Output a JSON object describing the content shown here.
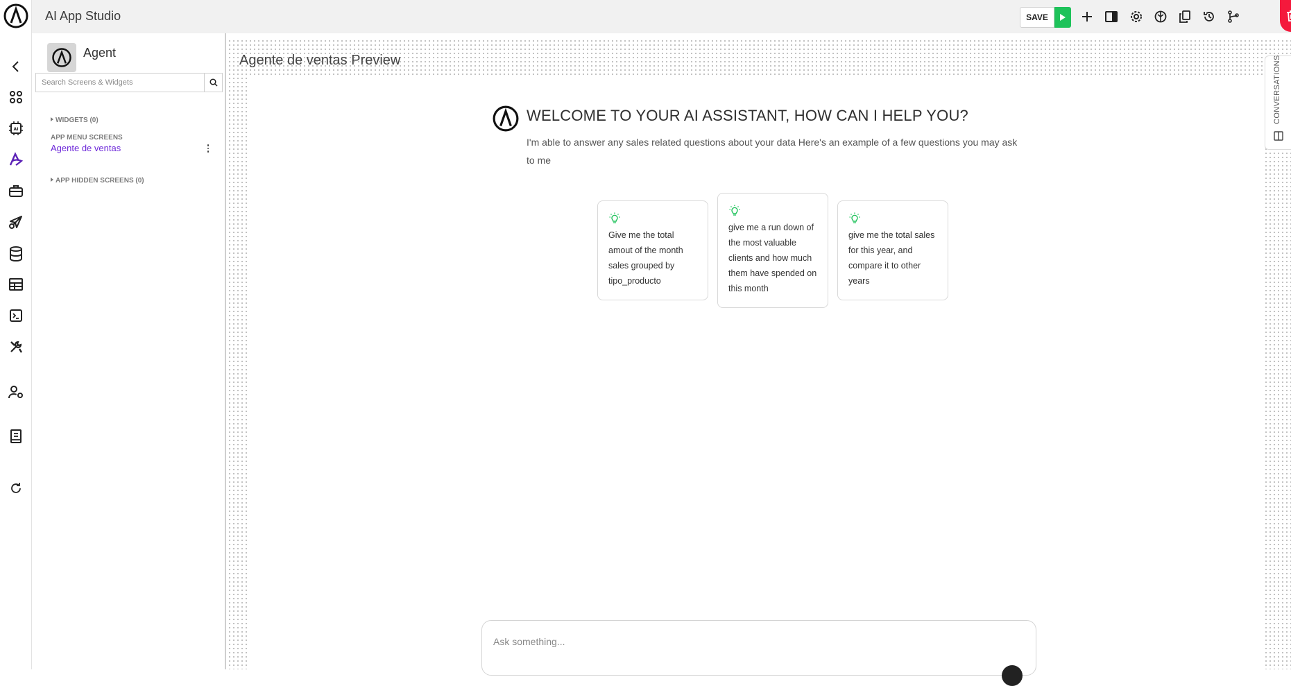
{
  "app": {
    "title": "AI App Studio"
  },
  "toolbar": {
    "save_label": "SAVE",
    "icons": [
      "plus-icon",
      "panel-icon",
      "gear-icon",
      "globe-icon",
      "copy-icon",
      "history-icon",
      "branch-icon",
      "trash-icon"
    ]
  },
  "rail": {
    "icons": [
      "logo",
      "back-icon",
      "apps-icon",
      "ai-chip-icon",
      "studio-icon",
      "toolbox-icon",
      "send-icon",
      "database-icon",
      "table-icon",
      "terminal-icon",
      "tools-icon",
      "user-settings-icon",
      "book-icon",
      "refresh-icon"
    ]
  },
  "panel": {
    "agent_name": "Agent",
    "search_placeholder": "Search Screens & Widgets",
    "widgets_label": "WIDGETS (0)",
    "app_menu_label": "APP MENU SCREENS",
    "screen_item": "Agente de ventas",
    "hidden_label": "APP HIDDEN SCREENS (0)"
  },
  "preview": {
    "title": "Agente de ventas Preview",
    "welcome_title": "WELCOME TO YOUR AI ASSISTANT, HOW CAN I HELP YOU?",
    "welcome_desc": "I'm able to answer any sales related questions about your data Here's an example of a few questions you may ask to me",
    "cards": [
      {
        "text": "Give me the total amout of the month sales grouped by tipo_producto"
      },
      {
        "text": "give me a run down of the most valuable clients and how much them have spended on this month"
      },
      {
        "text": "give me the total sales for this year, and compare it to other years"
      }
    ],
    "ask_placeholder": "Ask something...",
    "conversations_label": "CONVERSATIONS"
  },
  "colors": {
    "accent": "#6d28d9",
    "play": "#1ec25a",
    "delete": "#f4193c",
    "bulb": "#1ec25a"
  }
}
